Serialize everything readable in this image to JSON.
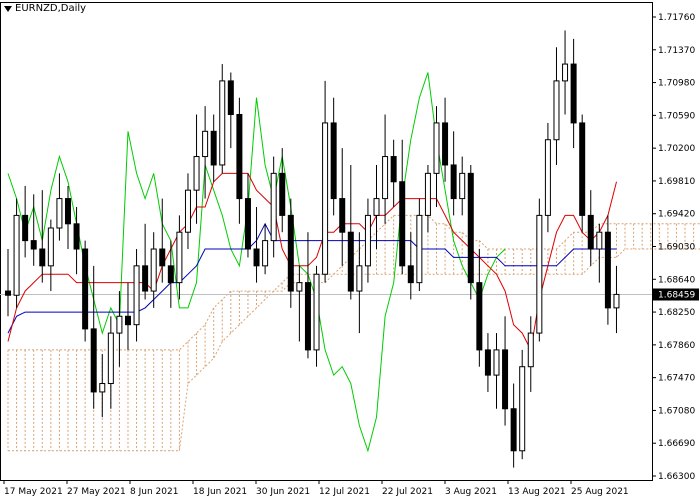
{
  "window": {
    "symbol": "EURNZD",
    "timeframe": "Daily",
    "title": "EURNZD,Daily"
  },
  "colors": {
    "background": "#ffffff",
    "candle_bull": "#ffffff",
    "candle_bear": "#000000",
    "candle_outline": "#000000",
    "tenkan": "#dd0000",
    "kijun": "#0000bb",
    "chikou": "#00cc00",
    "kumo": "#d9a273",
    "bid_line": "#c0c0c0",
    "price_tag_bg": "#000000",
    "price_tag_text": "#ffffff"
  },
  "price_axis": {
    "labels": [
      "1.71760",
      "1.71370",
      "1.70980",
      "1.70590",
      "1.70200",
      "1.69810",
      "1.69420",
      "1.69030",
      "1.68640",
      "1.68250",
      "1.67860",
      "1.67470",
      "1.67080",
      "1.66690",
      "1.66300"
    ],
    "current_price": "1.68459"
  },
  "time_axis": {
    "labels": [
      "17 May 2021",
      "27 May 2021",
      "8 Jun 2021",
      "18 Jun 2021",
      "30 Jun 2021",
      "12 Jul 2021",
      "22 Jul 2021",
      "3 Aug 2021",
      "13 Aug 2021",
      "25 Aug 2021"
    ]
  },
  "chart_data": {
    "type": "candlestick",
    "x_labels": [
      "17 May 2021",
      "27 May 2021",
      "8 Jun 2021",
      "18 Jun 2021",
      "30 Jun 2021",
      "12 Jul 2021",
      "22 Jul 2021",
      "3 Aug 2021",
      "13 Aug 2021",
      "25 Aug 2021"
    ],
    "ylim": [
      1.663,
      1.7176
    ],
    "candles": [
      [
        1.685,
        1.69,
        1.682,
        1.6845
      ],
      [
        1.6845,
        1.696,
        1.683,
        1.694
      ],
      [
        1.694,
        1.6975,
        1.689,
        1.691
      ],
      [
        1.691,
        1.6965,
        1.688,
        1.69
      ],
      [
        1.69,
        1.697,
        1.686,
        1.688
      ],
      [
        1.688,
        1.6935,
        1.685,
        1.6925
      ],
      [
        1.6925,
        1.699,
        1.691,
        1.696
      ],
      [
        1.696,
        1.6975,
        1.69,
        1.693
      ],
      [
        1.693,
        1.695,
        1.687,
        1.69
      ],
      [
        1.69,
        1.691,
        1.679,
        1.6805
      ],
      [
        1.6805,
        1.688,
        1.671,
        1.673
      ],
      [
        1.673,
        1.6775,
        1.67,
        1.674
      ],
      [
        1.674,
        1.682,
        1.671,
        1.68
      ],
      [
        1.68,
        1.685,
        1.676,
        1.682
      ],
      [
        1.682,
        1.686,
        1.678,
        1.681
      ],
      [
        1.681,
        1.69,
        1.679,
        1.688
      ],
      [
        1.688,
        1.693,
        1.684,
        1.685
      ],
      [
        1.685,
        1.692,
        1.683,
        1.69
      ],
      [
        1.69,
        1.696,
        1.686,
        1.688
      ],
      [
        1.688,
        1.691,
        1.683,
        1.686
      ],
      [
        1.686,
        1.694,
        1.684,
        1.692
      ],
      [
        1.692,
        1.699,
        1.69,
        1.697
      ],
      [
        1.697,
        1.706,
        1.693,
        1.701
      ],
      [
        1.701,
        1.707,
        1.696,
        1.704
      ],
      [
        1.704,
        1.706,
        1.698,
        1.7
      ],
      [
        1.7,
        1.712,
        1.699,
        1.71
      ],
      [
        1.71,
        1.711,
        1.702,
        1.706
      ],
      [
        1.706,
        1.708,
        1.693,
        1.696
      ],
      [
        1.696,
        1.699,
        1.689,
        1.69
      ],
      [
        1.69,
        1.695,
        1.686,
        1.688
      ],
      [
        1.688,
        1.693,
        1.687,
        1.691
      ],
      [
        1.691,
        1.701,
        1.689,
        1.699
      ],
      [
        1.699,
        1.702,
        1.692,
        1.694
      ],
      [
        1.694,
        1.696,
        1.683,
        1.685
      ],
      [
        1.685,
        1.688,
        1.679,
        1.686
      ],
      [
        1.686,
        1.692,
        1.677,
        1.678
      ],
      [
        1.678,
        1.688,
        1.676,
        1.687
      ],
      [
        1.687,
        1.71,
        1.686,
        1.705
      ],
      [
        1.705,
        1.708,
        1.694,
        1.696
      ],
      [
        1.696,
        1.702,
        1.688,
        1.692
      ],
      [
        1.692,
        1.7,
        1.684,
        1.685
      ],
      [
        1.685,
        1.692,
        1.68,
        1.688
      ],
      [
        1.688,
        1.696,
        1.686,
        1.694
      ],
      [
        1.694,
        1.7,
        1.69,
        1.696
      ],
      [
        1.696,
        1.706,
        1.693,
        1.701
      ],
      [
        1.701,
        1.703,
        1.695,
        1.698
      ],
      [
        1.698,
        1.703,
        1.687,
        1.688
      ],
      [
        1.688,
        1.692,
        1.684,
        1.686
      ],
      [
        1.686,
        1.696,
        1.685,
        1.694
      ],
      [
        1.694,
        1.7,
        1.692,
        1.699
      ],
      [
        1.699,
        1.707,
        1.695,
        1.705
      ],
      [
        1.705,
        1.708,
        1.698,
        1.7
      ],
      [
        1.7,
        1.704,
        1.694,
        1.696
      ],
      [
        1.696,
        1.701,
        1.694,
        1.699
      ],
      [
        1.699,
        1.7,
        1.684,
        1.686
      ],
      [
        1.686,
        1.69,
        1.676,
        1.678
      ],
      [
        1.678,
        1.68,
        1.673,
        1.675
      ],
      [
        1.675,
        1.68,
        1.671,
        1.678
      ],
      [
        1.678,
        1.682,
        1.669,
        1.671
      ],
      [
        1.671,
        1.674,
        1.664,
        1.666
      ],
      [
        1.666,
        1.678,
        1.665,
        1.676
      ],
      [
        1.676,
        1.682,
        1.673,
        1.68
      ],
      [
        1.68,
        1.696,
        1.679,
        1.694
      ],
      [
        1.694,
        1.705,
        1.692,
        1.703
      ],
      [
        1.703,
        1.714,
        1.7,
        1.71
      ],
      [
        1.71,
        1.716,
        1.706,
        1.712
      ],
      [
        1.712,
        1.715,
        1.702,
        1.705
      ],
      [
        1.705,
        1.706,
        1.692,
        1.694
      ],
      [
        1.694,
        1.697,
        1.688,
        1.69
      ],
      [
        1.69,
        1.693,
        1.686,
        1.692
      ],
      [
        1.692,
        1.694,
        1.681,
        1.683
      ],
      [
        1.683,
        1.688,
        1.68,
        1.6846
      ]
    ],
    "tenkan": [
      1.679,
      1.683,
      1.685,
      1.686,
      1.687,
      1.687,
      1.687,
      1.687,
      1.686,
      1.686,
      1.686,
      1.686,
      1.686,
      1.686,
      1.686,
      1.686,
      1.686,
      1.685,
      1.688,
      1.69,
      1.692,
      1.693,
      1.695,
      1.695,
      1.698,
      1.699,
      1.699,
      1.699,
      1.699,
      1.697,
      1.696,
      1.695,
      1.69,
      1.688,
      1.688,
      1.688,
      1.689,
      1.692,
      1.692,
      1.693,
      1.693,
      1.693,
      1.692,
      1.694,
      1.694,
      1.695,
      1.696,
      1.696,
      1.696,
      1.696,
      1.696,
      1.694,
      1.692,
      1.691,
      1.69,
      1.689,
      1.688,
      1.687,
      1.685,
      1.681,
      1.68,
      1.678,
      1.684,
      1.688,
      1.692,
      1.694,
      1.694,
      1.692,
      1.691,
      1.692,
      1.694,
      1.698
    ],
    "kijun": [
      1.68,
      1.682,
      1.6825,
      1.6825,
      1.6825,
      1.6825,
      1.6825,
      1.6825,
      1.6825,
      1.6825,
      1.6825,
      1.6825,
      1.6825,
      1.6825,
      1.6825,
      1.6825,
      1.683,
      1.684,
      1.685,
      1.686,
      1.686,
      1.687,
      1.688,
      1.69,
      1.69,
      1.69,
      1.69,
      1.69,
      1.69,
      1.691,
      1.693,
      1.691,
      1.691,
      1.691,
      1.691,
      1.691,
      1.691,
      1.691,
      1.691,
      1.691,
      1.691,
      1.691,
      1.691,
      1.691,
      1.691,
      1.691,
      1.691,
      1.691,
      1.69,
      1.69,
      1.69,
      1.69,
      1.689,
      1.689,
      1.689,
      1.689,
      1.689,
      1.689,
      1.688,
      1.688,
      1.688,
      1.688,
      1.688,
      1.688,
      1.688,
      1.689,
      1.69,
      1.69,
      1.69,
      1.69,
      1.69,
      1.69
    ],
    "chikou": [
      1.699,
      1.696,
      1.692,
      1.695,
      1.691,
      1.697,
      1.701,
      1.698,
      1.693,
      1.688,
      1.684,
      1.68,
      1.683,
      1.681,
      1.704,
      1.699,
      1.696,
      1.699,
      1.693,
      1.691,
      1.683,
      1.683,
      1.686,
      1.7,
      1.697,
      1.694,
      1.69,
      1.688,
      1.695,
      1.708,
      1.7,
      1.696,
      1.701,
      1.695,
      1.688,
      1.687,
      1.684,
      1.678,
      1.675,
      1.676,
      1.674,
      1.669,
      1.666,
      1.67,
      1.682,
      1.686,
      1.696,
      1.703,
      1.708,
      1.711,
      1.703,
      1.697,
      1.691,
      1.688,
      1.686,
      1.684,
      1.687,
      1.689,
      1.69
    ],
    "senkou_a": [
      1.678,
      1.678,
      1.678,
      1.678,
      1.678,
      1.678,
      1.678,
      1.678,
      1.678,
      1.678,
      1.678,
      1.678,
      1.678,
      1.678,
      1.678,
      1.678,
      1.678,
      1.678,
      1.678,
      1.678,
      1.678,
      1.679,
      1.68,
      1.681,
      1.683,
      1.684,
      1.685,
      1.685,
      1.685,
      1.685,
      1.685,
      1.685,
      1.685,
      1.686,
      1.686,
      1.686,
      1.686,
      1.686,
      1.687,
      1.688,
      1.689,
      1.69,
      1.691,
      1.692,
      1.693,
      1.694,
      1.694,
      1.694,
      1.694,
      1.694,
      1.693,
      1.693,
      1.692,
      1.692,
      1.691,
      1.691,
      1.69,
      1.69,
      1.69,
      1.69,
      1.69,
      1.69,
      1.69,
      1.69,
      1.69,
      1.691,
      1.692,
      1.692,
      1.692,
      1.693,
      1.693,
      1.693,
      1.693,
      1.693,
      1.693,
      1.693,
      1.693,
      1.693,
      1.693,
      1.693,
      1.693,
      1.693
    ],
    "senkou_b": [
      1.666,
      1.666,
      1.666,
      1.666,
      1.666,
      1.666,
      1.666,
      1.666,
      1.666,
      1.666,
      1.666,
      1.666,
      1.666,
      1.666,
      1.666,
      1.666,
      1.666,
      1.666,
      1.666,
      1.666,
      1.666,
      1.674,
      1.675,
      1.676,
      1.677,
      1.679,
      1.68,
      1.681,
      1.682,
      1.683,
      1.684,
      1.685,
      1.686,
      1.687,
      1.687,
      1.687,
      1.687,
      1.687,
      1.687,
      1.687,
      1.687,
      1.687,
      1.687,
      1.687,
      1.687,
      1.687,
      1.687,
      1.687,
      1.687,
      1.687,
      1.687,
      1.687,
      1.687,
      1.687,
      1.687,
      1.687,
      1.687,
      1.687,
      1.687,
      1.687,
      1.687,
      1.687,
      1.687,
      1.687,
      1.687,
      1.687,
      1.687,
      1.687,
      1.688,
      1.689,
      1.689,
      1.689,
      1.69,
      1.69,
      1.69,
      1.69,
      1.69,
      1.69,
      1.69,
      1.69,
      1.69,
      1.69
    ]
  }
}
